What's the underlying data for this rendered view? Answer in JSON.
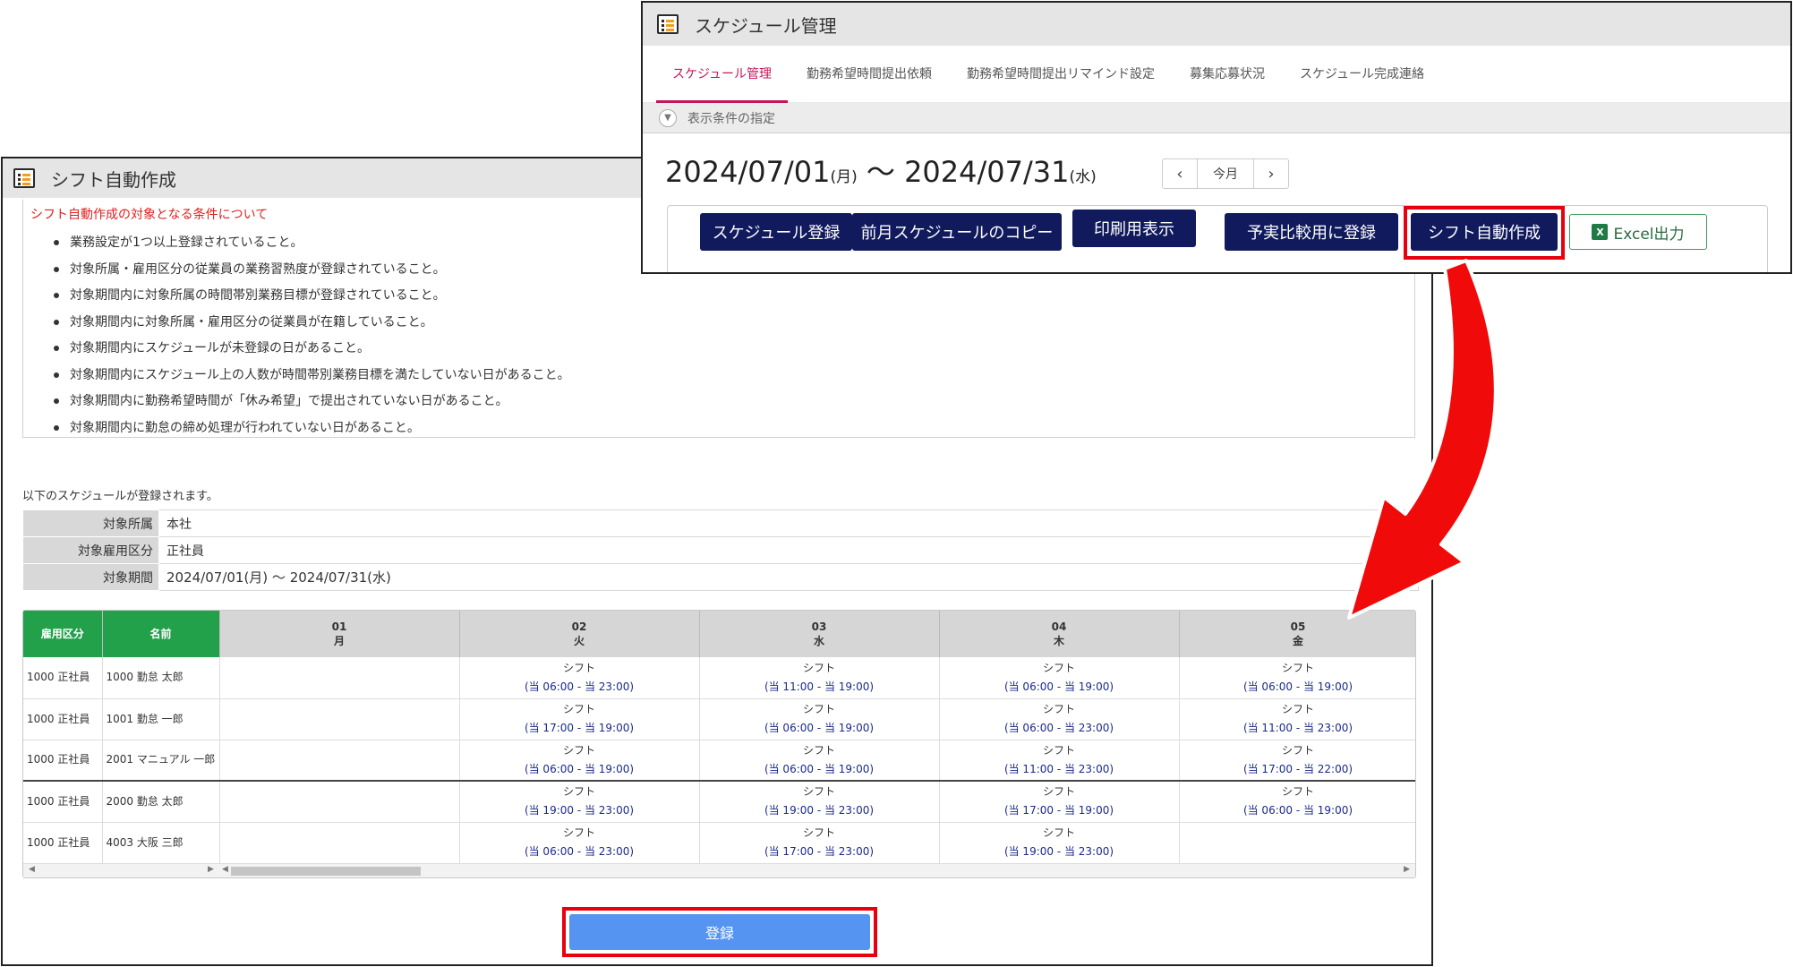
{
  "shift_panel": {
    "title": "シフト自動作成",
    "conditions_title": "シフト自動作成の対象となる条件について",
    "conditions": [
      "業務設定が1つ以上登録されていること。",
      "対象所属・雇用区分の従業員の業務習熟度が登録されていること。",
      "対象期間内に対象所属の時間帯別業務目標が登録されていること。",
      "対象期間内に対象所属・雇用区分の従業員が在籍していること。",
      "対象期間内にスケジュールが未登録の日があること。",
      "対象期間内にスケジュール上の人数が時間帯別業務目標を満たしていない日があること。",
      "対象期間内に勤務希望時間が「休み希望」で提出されていない日があること。",
      "対象期間内に勤怠の締め処理が行われていない日があること。"
    ],
    "register_note": "以下のスケジュールが登録されます。",
    "info": [
      {
        "label": "対象所属",
        "value": "本社"
      },
      {
        "label": "対象雇用区分",
        "value": "正社員"
      },
      {
        "label": "対象期間",
        "value": "2024/07/01(月) ～ 2024/07/31(水)"
      }
    ],
    "grid": {
      "headers": {
        "employment": "雇用区分",
        "name": "名前"
      },
      "days": [
        {
          "day": "01",
          "dow": "月"
        },
        {
          "day": "02",
          "dow": "火"
        },
        {
          "day": "03",
          "dow": "水"
        },
        {
          "day": "04",
          "dow": "木"
        },
        {
          "day": "05",
          "dow": "金"
        }
      ],
      "shift_label": "シフト",
      "rows": [
        {
          "employment": "1000 正社員",
          "name": "1000 勤怠 太郎",
          "shifts": [
            "",
            "(当 06:00 - 当 23:00)",
            "(当 11:00 - 当 19:00)",
            "(当 06:00 - 当 19:00)",
            "(当 06:00 - 当 19:00)"
          ]
        },
        {
          "employment": "1000 正社員",
          "name": "1001 勤怠 一郎",
          "shifts": [
            "",
            "(当 17:00 - 当 19:00)",
            "(当 06:00 - 当 19:00)",
            "(当 06:00 - 当 23:00)",
            "(当 11:00 - 当 23:00)"
          ]
        },
        {
          "employment": "1000 正社員",
          "name": "2001 マニュアル 一郎",
          "shifts": [
            "",
            "(当 06:00 - 当 19:00)",
            "(当 06:00 - 当 19:00)",
            "(当 11:00 - 当 23:00)",
            "(当 17:00 - 当 22:00)"
          ]
        },
        {
          "employment": "1000 正社員",
          "name": "2000 勤怠 太郎",
          "shifts": [
            "",
            "(当 19:00 - 当 23:00)",
            "(当 19:00 - 当 23:00)",
            "(当 17:00 - 当 19:00)",
            "(当 06:00 - 当 19:00)"
          ]
        },
        {
          "employment": "1000 正社員",
          "name": "4003 大阪 三郎",
          "shifts": [
            "",
            "(当 06:00 - 当 23:00)",
            "(当 17:00 - 当 23:00)",
            "(当 19:00 - 当 23:00)",
            ""
          ]
        }
      ]
    },
    "register_button": "登録"
  },
  "schedule_panel": {
    "title": "スケジュール管理",
    "tabs": [
      "スケジュール管理",
      "勤務希望時間提出依頼",
      "勤務希望時間提出リマインド設定",
      "募集応募状況",
      "スケジュール完成連絡"
    ],
    "active_tab": 0,
    "condition_bar": "表示条件の指定",
    "date_start": "2024/07/01",
    "date_start_dow": "(月)",
    "date_sep": " ～ ",
    "date_end": "2024/07/31",
    "date_end_dow": "(水)",
    "today_button": "今月",
    "actions": [
      "スケジュール登録",
      "前月スケジュールのコピー",
      "印刷用表示",
      "予実比較用に登録",
      "シフト自動作成"
    ],
    "excel_button": "Excel出力"
  },
  "colors": {
    "highlight": "#e8000e",
    "navy_button": "#101a5c",
    "green_header": "#23a04a",
    "register_button": "#5594f0",
    "active_tab": "#c2185b"
  }
}
